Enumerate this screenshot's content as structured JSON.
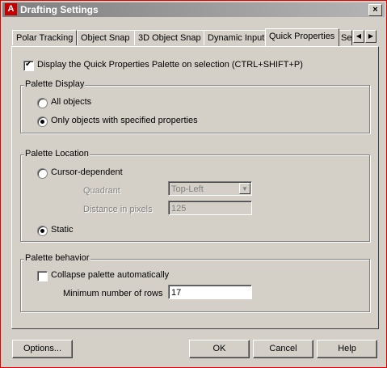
{
  "window": {
    "title": "Drafting Settings",
    "app_icon_letter": "A",
    "close_glyph": "×"
  },
  "tabs": [
    {
      "label": "Polar Tracking",
      "active": false
    },
    {
      "label": "Object Snap",
      "active": false
    },
    {
      "label": "3D Object Snap",
      "active": false
    },
    {
      "label": "Dynamic Input",
      "active": false
    },
    {
      "label": "Quick Properties",
      "active": true
    },
    {
      "label": "Se",
      "active": false
    }
  ],
  "tab_scroll": {
    "left_glyph": "◀",
    "right_glyph": "▶"
  },
  "display_qp": {
    "label": "Display the Quick Properties Palette on selection (CTRL+SHIFT+P)",
    "checked": true
  },
  "palette_display": {
    "title": "Palette Display",
    "options": [
      {
        "label": "All objects",
        "selected": false
      },
      {
        "label": "Only objects with specified properties",
        "selected": true
      }
    ]
  },
  "palette_location": {
    "title": "Palette Location",
    "cursor_dependent": {
      "label": "Cursor-dependent",
      "selected": false
    },
    "quadrant": {
      "label": "Quadrant",
      "value": "Top-Left",
      "arrow_glyph": "▼",
      "enabled": false
    },
    "distance": {
      "label": "Distance in pixels",
      "value": "125",
      "enabled": false
    },
    "static": {
      "label": "Static",
      "selected": true
    }
  },
  "palette_behavior": {
    "title": "Palette behavior",
    "collapse": {
      "label": "Collapse palette automatically",
      "checked": false
    },
    "min_rows": {
      "label": "Minimum number of rows",
      "value": "17"
    }
  },
  "buttons": {
    "options": "Options...",
    "ok": "OK",
    "cancel": "Cancel",
    "help": "Help"
  },
  "colors": {
    "frame_border": "#e00000",
    "dialog_bg": "#d4d0c8",
    "titlebar": "#8c8c8c",
    "app_icon": "#c40000"
  }
}
